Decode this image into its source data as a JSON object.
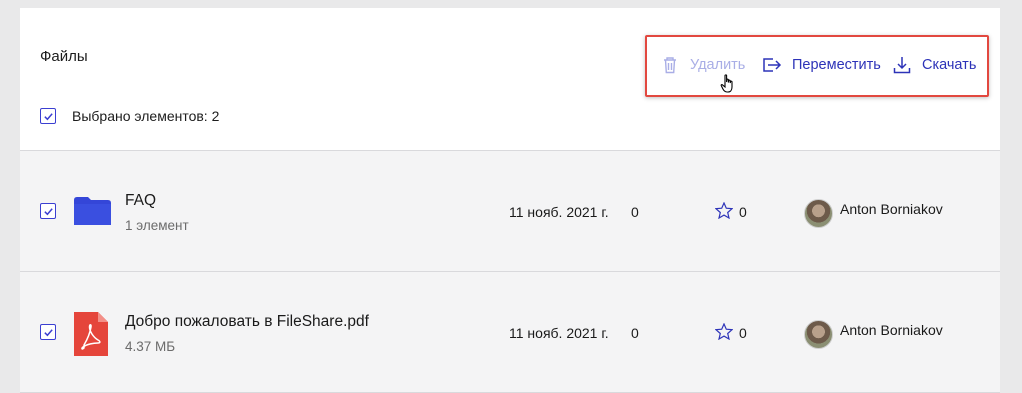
{
  "header": {
    "title": "Файлы",
    "selected_count_text": "Выбрано элементов: 2"
  },
  "actions": {
    "delete_label": "Удалить",
    "move_label": "Переместить",
    "download_label": "Скачать"
  },
  "files": [
    {
      "name": "FAQ",
      "subtitle": "1 элемент",
      "date": "11 нояб. 2021 г.",
      "count": "0",
      "stars": "0",
      "owner": "Anton Borniakov",
      "icon": "folder-icon",
      "checked": true
    },
    {
      "name": "Добро пожаловать в FileShare.pdf",
      "subtitle": "4.37 МБ",
      "date": "11 нояб. 2021 г.",
      "count": "0",
      "stars": "0",
      "owner": "Anton Borniakov",
      "icon": "pdf-file-icon",
      "checked": true
    }
  ],
  "colors": {
    "accent": "#2d33b8",
    "disabled_action": "#a9aee6",
    "highlight_border": "#e2483f",
    "folder": "#3446d8",
    "pdf": "#e5453b"
  }
}
